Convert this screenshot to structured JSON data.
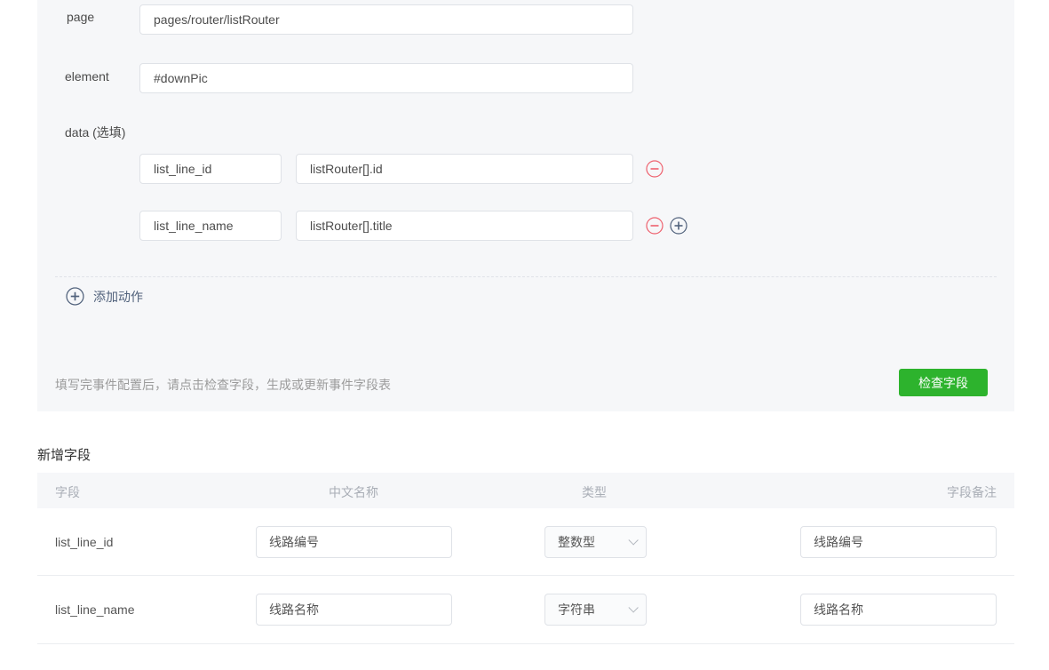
{
  "panel": {
    "fields": [
      {
        "label": "page",
        "value": "pages/router/listRouter"
      },
      {
        "label": "element",
        "value": "#downPic"
      }
    ],
    "data_label": "data (选填)",
    "data_pairs": [
      {
        "key": "list_line_id",
        "value": "listRouter[].id"
      },
      {
        "key": "list_line_name",
        "value": "listRouter[].title"
      }
    ],
    "add_action_label": "添加动作",
    "hint": "填写完事件配置后，请点击检查字段，生成或更新事件字段表",
    "check_button_label": "检查字段"
  },
  "new_fields": {
    "title": "新增字段",
    "columns": {
      "field": "字段",
      "cn_name": "中文名称",
      "type": "类型",
      "remark": "字段备注"
    },
    "rows": [
      {
        "field": "list_line_id",
        "cn_name": "线路编号",
        "type": "整数型",
        "remark": "线路编号"
      },
      {
        "field": "list_line_name",
        "cn_name": "线路名称",
        "type": "字符串",
        "remark": "线路名称"
      }
    ]
  },
  "colors": {
    "panel_bg": "#f6f7f9",
    "button_green": "#2db32d",
    "remove_red": "#ee616e",
    "add_slate": "#51627c"
  }
}
